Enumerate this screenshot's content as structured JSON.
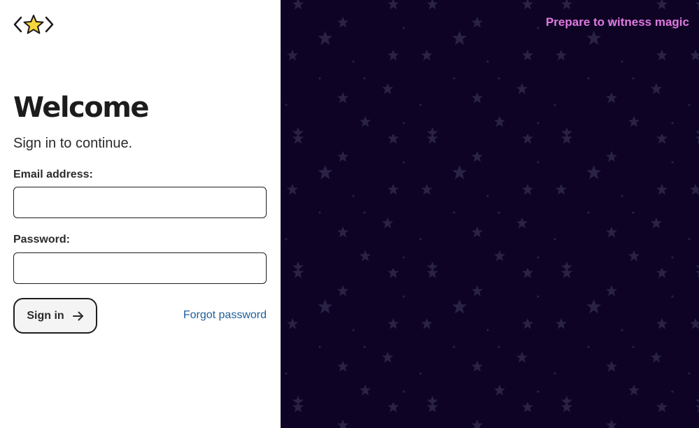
{
  "brand": {
    "logo_icon": "star-code-brackets-logo",
    "logo_star_color": "#f7d73a"
  },
  "login": {
    "title": "Welcome",
    "subtitle": "Sign in to continue.",
    "email_label": "Email address:",
    "email_value": "",
    "password_label": "Password:",
    "password_value": "",
    "signin_label": "Sign in",
    "signin_icon": "arrow-right-icon",
    "forgot_label": "Forgot password"
  },
  "promo": {
    "tagline": "Prepare to witness magic",
    "tagline_color": "#e07ae0",
    "background_color": "#0e0324",
    "star_color": "#2a2244",
    "pattern_icon": "star-icon"
  }
}
